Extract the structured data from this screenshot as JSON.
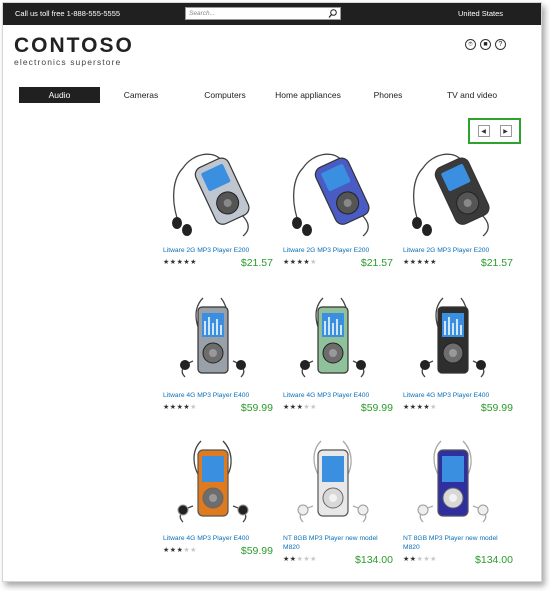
{
  "topbar": {
    "phone": "Call us toll free 1-888-555-5555",
    "search_placeholder": "Search...",
    "region": "United States"
  },
  "logo": {
    "brand": "CONTOSO",
    "tagline": "electronics superstore"
  },
  "utility_icons": [
    "location-icon",
    "cart-icon",
    "help-icon"
  ],
  "nav": {
    "items": [
      {
        "label": "Audio",
        "active": true
      },
      {
        "label": "Cameras",
        "active": false
      },
      {
        "label": "Computers",
        "active": false
      },
      {
        "label": "Home appliances",
        "active": false
      },
      {
        "label": "Phones",
        "active": false
      },
      {
        "label": "TV and video",
        "active": false
      }
    ]
  },
  "pager": {
    "prev_icon": "chevron-left-icon",
    "next_icon": "chevron-right-icon",
    "highlight_color": "#2fa12f"
  },
  "products": [
    {
      "name": "Litware 2G MP3 Player E200",
      "rating": 5,
      "price": "$21.57",
      "color": "#bfc6cf"
    },
    {
      "name": "Litware 2G MP3 Player E200",
      "rating": 4,
      "price": "$21.57",
      "color": "#4a5bc4"
    },
    {
      "name": "Litware 2G MP3 Player E200",
      "rating": 5,
      "price": "$21.57",
      "color": "#3a3a3a"
    },
    {
      "name": "Litware 4G MP3 Player E400",
      "rating": 4,
      "price": "$59.99",
      "color": "#9aa0a8"
    },
    {
      "name": "Litware 4G MP3 Player E400",
      "rating": 3,
      "price": "$59.99",
      "color": "#8fc29a"
    },
    {
      "name": "Litware 4G MP3 Player E400",
      "rating": 4,
      "price": "$59.99",
      "color": "#2e2e2e"
    },
    {
      "name": "Litware 4G MP3 Player E400",
      "rating": 3,
      "price": "$59.99",
      "color": "#e07a1e"
    },
    {
      "name": "NT 8GB MP3 Player new model M820",
      "rating": 2,
      "price": "$134.00",
      "color": "#e8e8e8"
    },
    {
      "name": "NT 8GB MP3 Player new model M820",
      "rating": 2,
      "price": "$134.00",
      "color": "#2f2fa0"
    }
  ],
  "colors": {
    "price": "#2a9c2a",
    "link": "#0b6fb8",
    "topbar": "#202020"
  }
}
